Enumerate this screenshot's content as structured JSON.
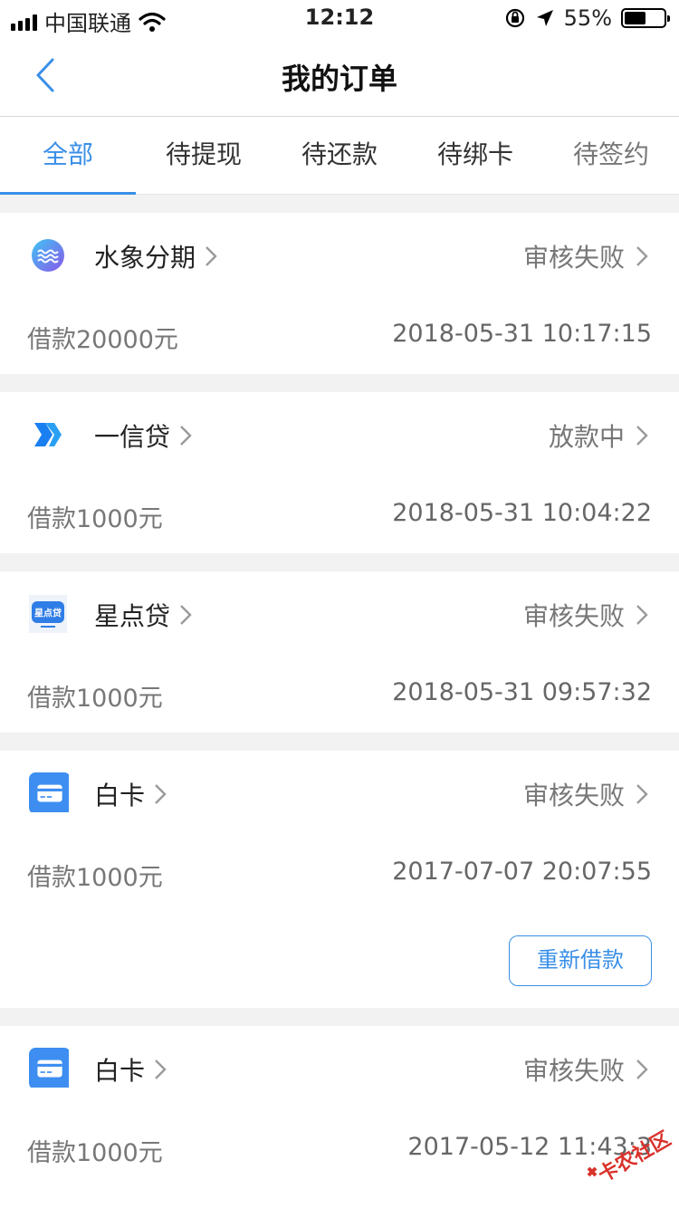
{
  "status_bar": {
    "carrier": "中国联通",
    "time": "12:12",
    "battery": "55%",
    "battery_level": 0.55
  },
  "nav": {
    "title": "我的订单",
    "back_icon": "chevron-left-icon"
  },
  "tabs": [
    {
      "label": "全部",
      "active": true
    },
    {
      "label": "待提现",
      "active": false
    },
    {
      "label": "待还款",
      "active": false
    },
    {
      "label": "待绑卡",
      "active": false
    },
    {
      "label": "待签约",
      "active": false
    }
  ],
  "orders": [
    {
      "lender": "水象分期",
      "status": "审核失败",
      "amount": "借款20000元",
      "time": "2018-05-31 10:17:15",
      "logo": "shuixiang-logo-icon"
    },
    {
      "lender": "一信贷",
      "status": "放款中",
      "amount": "借款1000元",
      "time": "2018-05-31 10:04:22",
      "logo": "yixindai-logo-icon"
    },
    {
      "lender": "星点贷",
      "status": "审核失败",
      "amount": "借款1000元",
      "time": "2018-05-31 09:57:32",
      "logo": "xingdiandai-logo-icon",
      "logo_text": "星点贷"
    },
    {
      "lender": "白卡",
      "status": "审核失败",
      "amount": "借款1000元",
      "time": "2017-07-07 20:07:55",
      "logo": "baika-card-icon",
      "action": "重新借款"
    },
    {
      "lender": "白卡",
      "status": "审核失败",
      "amount": "借款1000元",
      "time": "2017-05-12 11:43:3",
      "logo": "baika-card-icon"
    }
  ],
  "watermark": {
    "text": "卡农社区"
  },
  "colors": {
    "accent": "#3a8fe8",
    "muted": "#777777",
    "background": "#f2f2f2"
  }
}
